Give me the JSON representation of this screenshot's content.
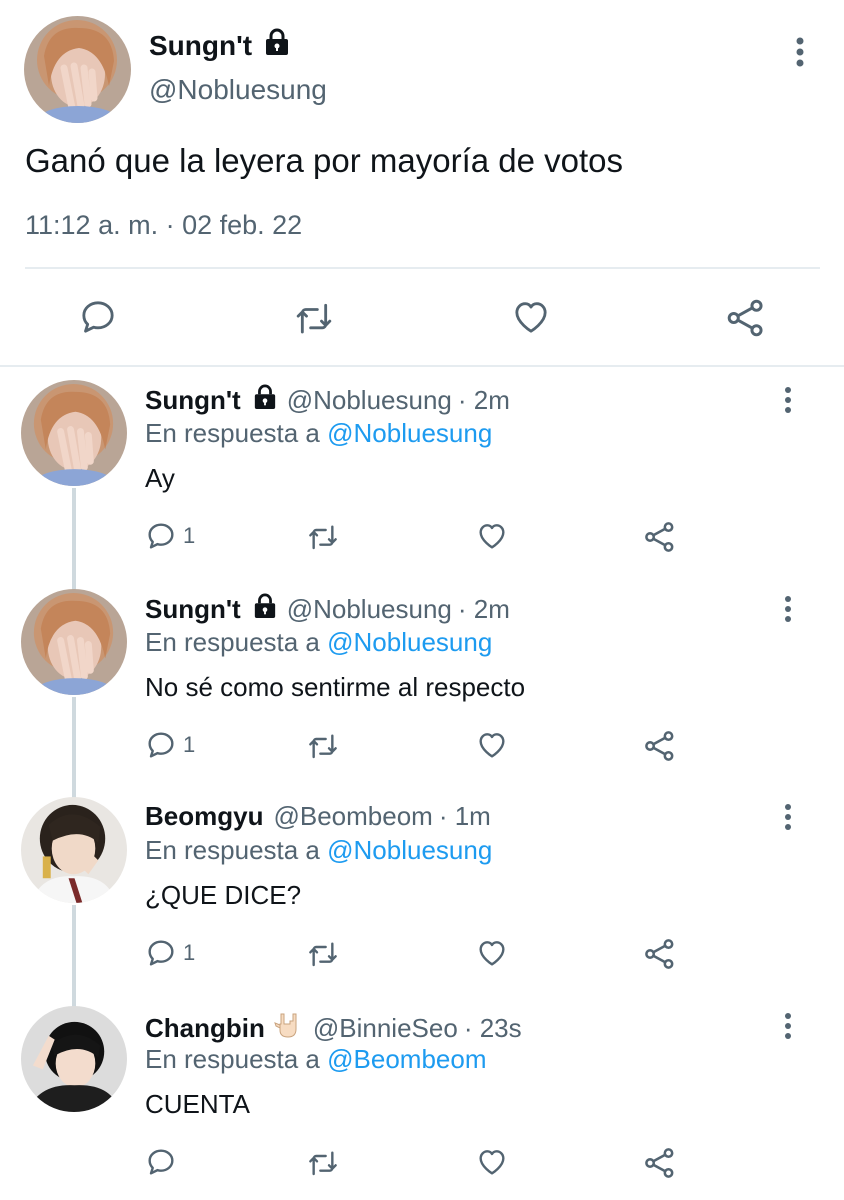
{
  "main_tweet": {
    "display_name": "Sungn't",
    "handle": "@Nobluesung",
    "text": "Ganó que la leyera por mayoría de votos",
    "timestamp": "11:12 a. m. · 02 feb. 22",
    "icons": {
      "lock": "lock-icon",
      "more": "more-vertical-icon",
      "reply": "reply-icon",
      "retweet": "retweet-icon",
      "like": "heart-icon",
      "share": "share-icon"
    }
  },
  "replies": [
    {
      "display_name": "Sungn't",
      "handle": "@Nobluesung",
      "time": "· 2m",
      "in_reply_prefix": "En respuesta a",
      "in_reply_to": "@Nobluesung",
      "text": "Ay",
      "reply_count": "1",
      "locked": true
    },
    {
      "display_name": "Sungn't",
      "handle": "@Nobluesung",
      "time": "· 2m",
      "in_reply_prefix": "En respuesta a",
      "in_reply_to": "@Nobluesung",
      "text": "No sé como sentirme al respecto",
      "reply_count": "1",
      "locked": true
    },
    {
      "display_name": "Beomgyu",
      "handle": "@Beombeom",
      "time": "· 1m",
      "in_reply_prefix": "En respuesta a",
      "in_reply_to": "@Nobluesung",
      "text": "¿QUE DICE?",
      "reply_count": "1",
      "locked": false
    },
    {
      "display_name": "Changbin",
      "handle": "@BinnieSeo",
      "time": "· 23s",
      "in_reply_prefix": "En respuesta a",
      "in_reply_to": "@Beombeom",
      "text": "CUENTA",
      "reply_count": "",
      "locked": false,
      "emoji": "🤟🏻"
    }
  ],
  "colors": {
    "text_primary": "#0f1419",
    "text_secondary": "#536471",
    "link": "#1d9bf0",
    "icon": "#536471",
    "divider": "#e6ecf0"
  }
}
